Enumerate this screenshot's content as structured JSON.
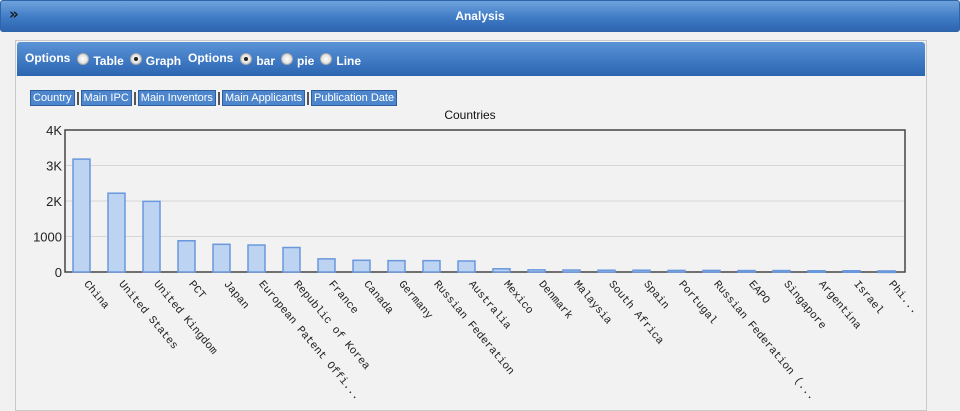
{
  "header": {
    "title": "Analysis",
    "collapse_icon": "double-chevron-down-icon"
  },
  "options": {
    "group1_label": "Options",
    "table_label": "Table",
    "graph_label": "Graph",
    "graph_selected": true,
    "group2_label": "Options",
    "bar_label": "bar",
    "pie_label": "pie",
    "line_label": "Line",
    "bar_selected": true
  },
  "tabs": [
    "Country",
    "Main IPC",
    "Main Inventors",
    "Main Applicants",
    "Publication Date"
  ],
  "chart_data": {
    "type": "bar",
    "title": "Countries",
    "ylim": [
      0,
      4000
    ],
    "yticks": [
      0,
      1000,
      2000,
      3000,
      4000
    ],
    "ytick_labels": [
      "0",
      "1000",
      "2K",
      "3K",
      "4K"
    ],
    "categories": [
      "China",
      "United States",
      "United Kingdom",
      "PCT",
      "Japan",
      "European Patent Offi...",
      "Republic of Korea",
      "France",
      "Canada",
      "Germany",
      "Russian Federation",
      "Australia",
      "Mexico",
      "Denmark",
      "Malaysia",
      "South Africa",
      "Spain",
      "Portugal",
      "Russian Federation (...",
      "EAPO",
      "Singapore",
      "Argentina",
      "Israel",
      "Phi..."
    ],
    "values": [
      3180,
      2220,
      1990,
      880,
      780,
      760,
      690,
      370,
      330,
      320,
      320,
      310,
      90,
      60,
      55,
      50,
      50,
      45,
      45,
      40,
      40,
      35,
      35,
      30
    ],
    "grid": true,
    "bar_color": "#bcd3f2",
    "bar_stroke": "#6a98dc"
  }
}
